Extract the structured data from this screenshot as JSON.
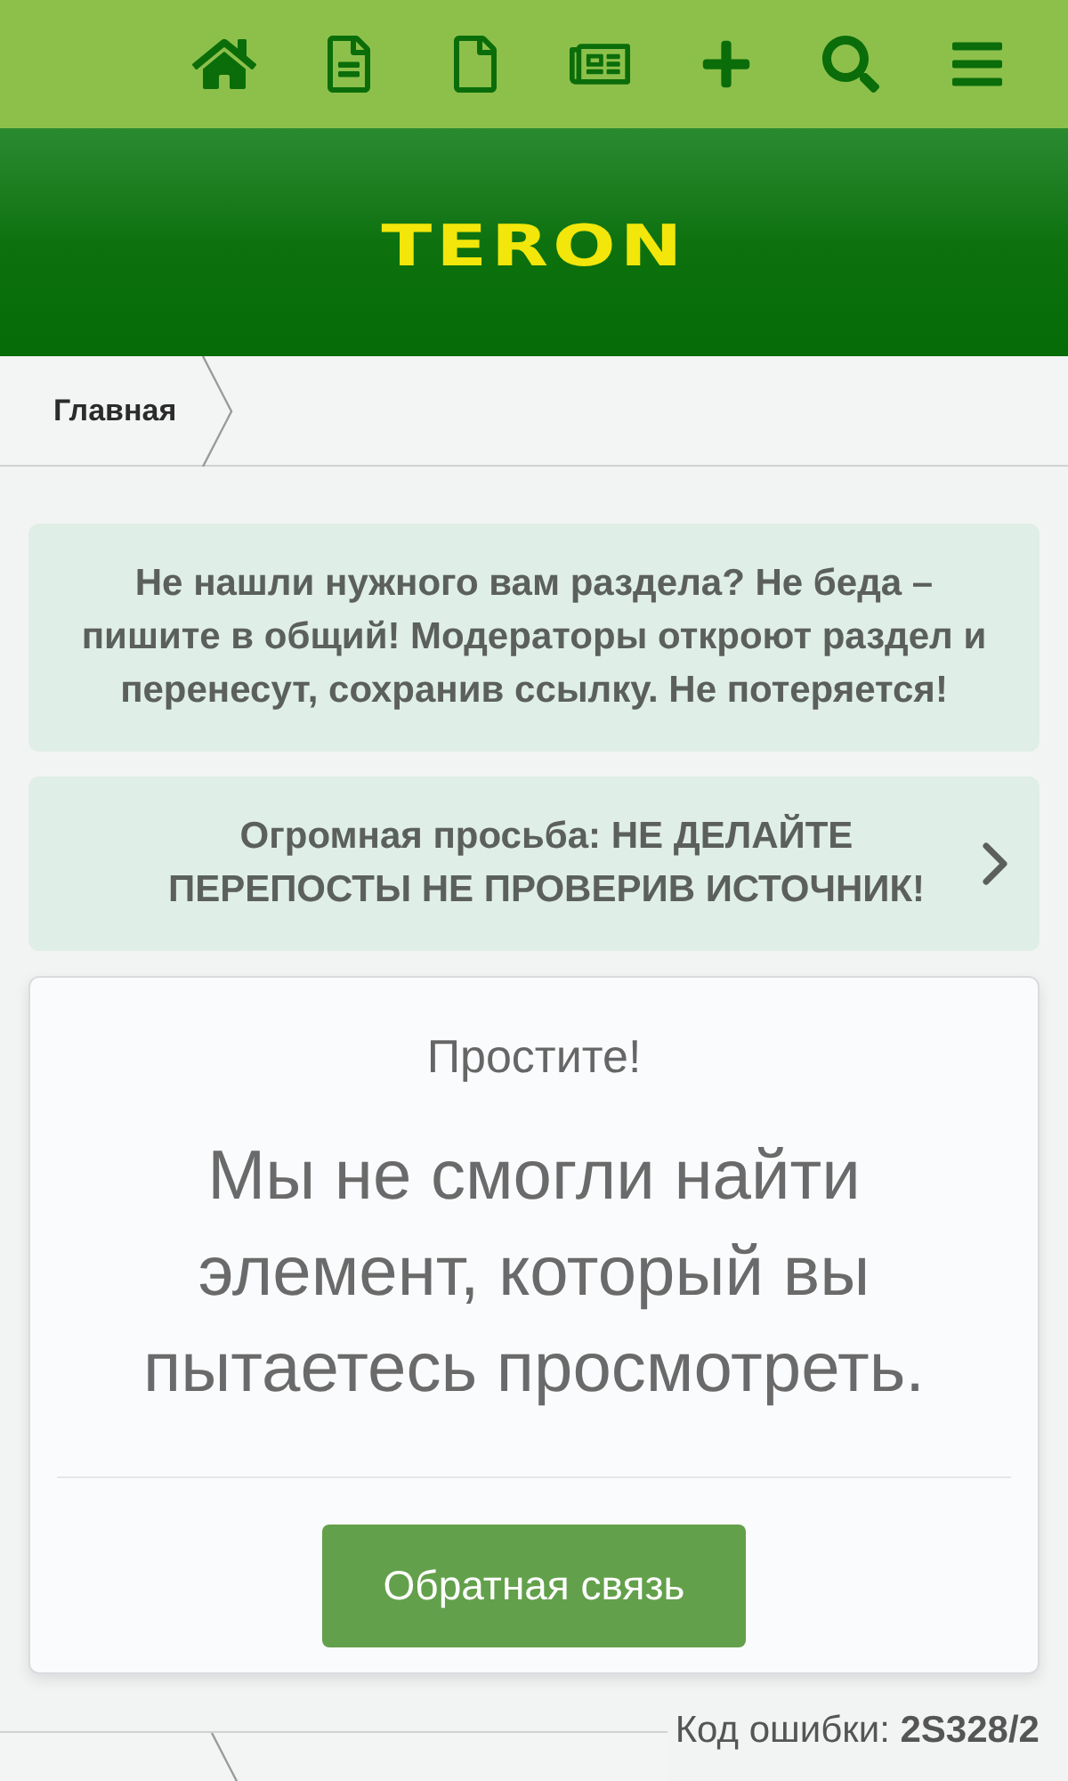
{
  "header": {
    "logo": "TERON"
  },
  "breadcrumb": {
    "items": [
      {
        "label": "Главная"
      }
    ]
  },
  "notices": [
    {
      "kind": "plain",
      "text": "Не нашли нужного вам раздела? Не беда – пишите в общий! Модераторы откроют раздел и перенесут, сохранив ссылку. Не потеряется!"
    },
    {
      "kind": "link",
      "text": "Огромная просьба: НЕ ДЕЛАЙТЕ ПЕРЕПОСТЫ НЕ ПРОВЕРИВ ИСТОЧНИК!"
    }
  ],
  "error_card": {
    "title": "Простите!",
    "message": "Мы не смогли найти элемент, который вы пытаетесь просмотреть.",
    "button": "Обратная связь"
  },
  "footer": {
    "error_code": "Код ошибки: **2S328/2**"
  }
}
